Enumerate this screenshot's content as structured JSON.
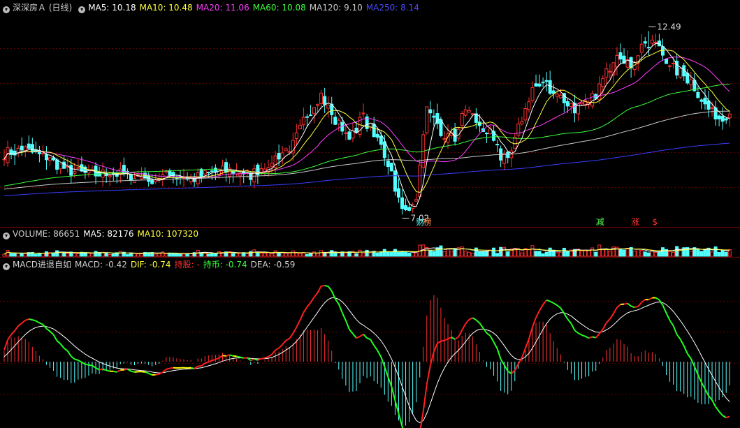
{
  "colors": {
    "up": "#ff3030",
    "down": "#54ffff",
    "grid": "#6a0000",
    "ma5": "#ffffff",
    "ma10": "#ffff3c",
    "ma20": "#ff3cff",
    "ma60": "#3cff3c",
    "ma120": "#c8c8c8",
    "ma250": "#3c3cff",
    "dea": "#ffffff",
    "difUp": "#ff2020",
    "difDown": "#20ff20",
    "difFlat": "#ffff00"
  },
  "price_header": {
    "icon": "circle-marker-icon",
    "title": "深深房Ａ (日线)",
    "ma5": "MA5: 10.18",
    "ma10": "MA10: 10.48",
    "ma20": "MA20: 11.06",
    "ma60": "MA60: 10.08",
    "ma120": "MA120: 9.10",
    "ma250": "MA250: 8.14"
  },
  "volume_header": {
    "icon": "circle-marker-icon",
    "volume": "VOLUME: 86651",
    "ma5": "MA5: 82176",
    "ma10": "MA10: 107320"
  },
  "macd_header": {
    "icon": "circle-marker-icon",
    "name": "MACD进退自如",
    "macd": "MACD: -0.42",
    "dif": "DIF: -0.74",
    "hold": "持股: -",
    "cash": "持币: -0.74",
    "dea": "DEA: -0.59"
  },
  "annotations": {
    "high_label": "12.49",
    "low_label": "7.02",
    "signals": [
      {
        "text": "财",
        "color": "#54ffff",
        "bar": 117
      },
      {
        "text": "榜",
        "color": "#ff9050",
        "bar": 119
      },
      {
        "text": "减",
        "color": "#54ff54",
        "bar": 168
      },
      {
        "text": "涨",
        "color": "#ff3030",
        "bar": 178
      },
      {
        "text": "$",
        "color": "#ff3030",
        "bar": 184
      }
    ]
  },
  "chart_data": {
    "type": "candlestick",
    "price_ylim": [
      6.8,
      13.0
    ],
    "volume_ylim": [
      0,
      300000
    ],
    "macd_ylim": [
      -2.0,
      1.7
    ],
    "high_point": {
      "bar": 183,
      "value": 12.49
    },
    "low_point": {
      "bar": 113,
      "value": 7.02
    },
    "anchors": [
      [
        0,
        8.85
      ],
      [
        6,
        8.95
      ],
      [
        12,
        8.7
      ],
      [
        18,
        8.35
      ],
      [
        24,
        8.2
      ],
      [
        30,
        8.25
      ],
      [
        36,
        8.2
      ],
      [
        42,
        8.1
      ],
      [
        48,
        8.2
      ],
      [
        54,
        8.1
      ],
      [
        60,
        8.3
      ],
      [
        66,
        8.35
      ],
      [
        70,
        8.2
      ],
      [
        76,
        8.65
      ],
      [
        82,
        9.1
      ],
      [
        86,
        10.0
      ],
      [
        90,
        10.6
      ],
      [
        94,
        9.8
      ],
      [
        98,
        9.4
      ],
      [
        102,
        9.9
      ],
      [
        106,
        9.3
      ],
      [
        110,
        8.3
      ],
      [
        113,
        7.02
      ],
      [
        117,
        7.6
      ],
      [
        120,
        10.1
      ],
      [
        124,
        9.4
      ],
      [
        128,
        9.3
      ],
      [
        131,
        10.2
      ],
      [
        135,
        9.7
      ],
      [
        138,
        9.4
      ],
      [
        141,
        8.75
      ],
      [
        144,
        8.9
      ],
      [
        147,
        9.9
      ],
      [
        150,
        10.8
      ],
      [
        154,
        10.9
      ],
      [
        158,
        10.5
      ],
      [
        162,
        10.2
      ],
      [
        166,
        10.3
      ],
      [
        170,
        11.0
      ],
      [
        174,
        11.9
      ],
      [
        178,
        11.5
      ],
      [
        183,
        12.4
      ],
      [
        187,
        11.8
      ],
      [
        191,
        11.3
      ],
      [
        195,
        11.0
      ],
      [
        199,
        10.3
      ],
      [
        202,
        9.9
      ],
      [
        206,
        10.05
      ]
    ],
    "series_names": [
      "MA5",
      "MA10",
      "MA20",
      "MA60",
      "MA120",
      "MA250",
      "MACD",
      "DIF",
      "DEA"
    ],
    "last_values": {
      "MA5": 10.18,
      "MA10": 10.48,
      "MA20": 11.06,
      "MA60": 10.08,
      "MA120": 9.1,
      "MA250": 8.14,
      "VOLUME": 86651,
      "VOL_MA5": 82176,
      "VOL_MA10": 107320,
      "MACD": -0.42,
      "DIF": -0.74,
      "DEA": -0.59
    }
  }
}
